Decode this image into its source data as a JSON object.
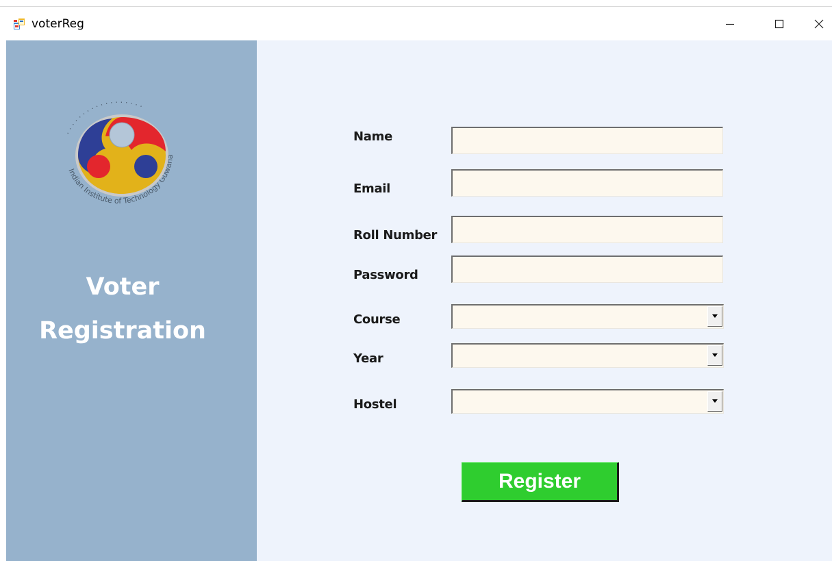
{
  "window": {
    "title": "voterReg",
    "controls": {
      "minimize_icon": "minimize-icon",
      "maximize_icon": "maximize-icon",
      "close_icon": "close-icon"
    }
  },
  "sidebar": {
    "title_line1": "Voter",
    "title_line2": "Registration",
    "background": "#96b2cc",
    "logo": {
      "name": "iit-guwahati-logo",
      "text": "Indian Institute of Technology Guwahati"
    }
  },
  "form": {
    "background": "#eef3fc",
    "fields": {
      "name": {
        "label": "Name",
        "value": ""
      },
      "email": {
        "label": "Email",
        "value": ""
      },
      "roll_number": {
        "label": "Roll Number",
        "value": ""
      },
      "password": {
        "label": "Password",
        "value": ""
      },
      "course": {
        "label": "Course",
        "selected": ""
      },
      "year": {
        "label": "Year",
        "selected": ""
      },
      "hostel": {
        "label": "Hostel",
        "selected": ""
      }
    },
    "register_label": "Register",
    "register_color": "#2fcd2f"
  }
}
